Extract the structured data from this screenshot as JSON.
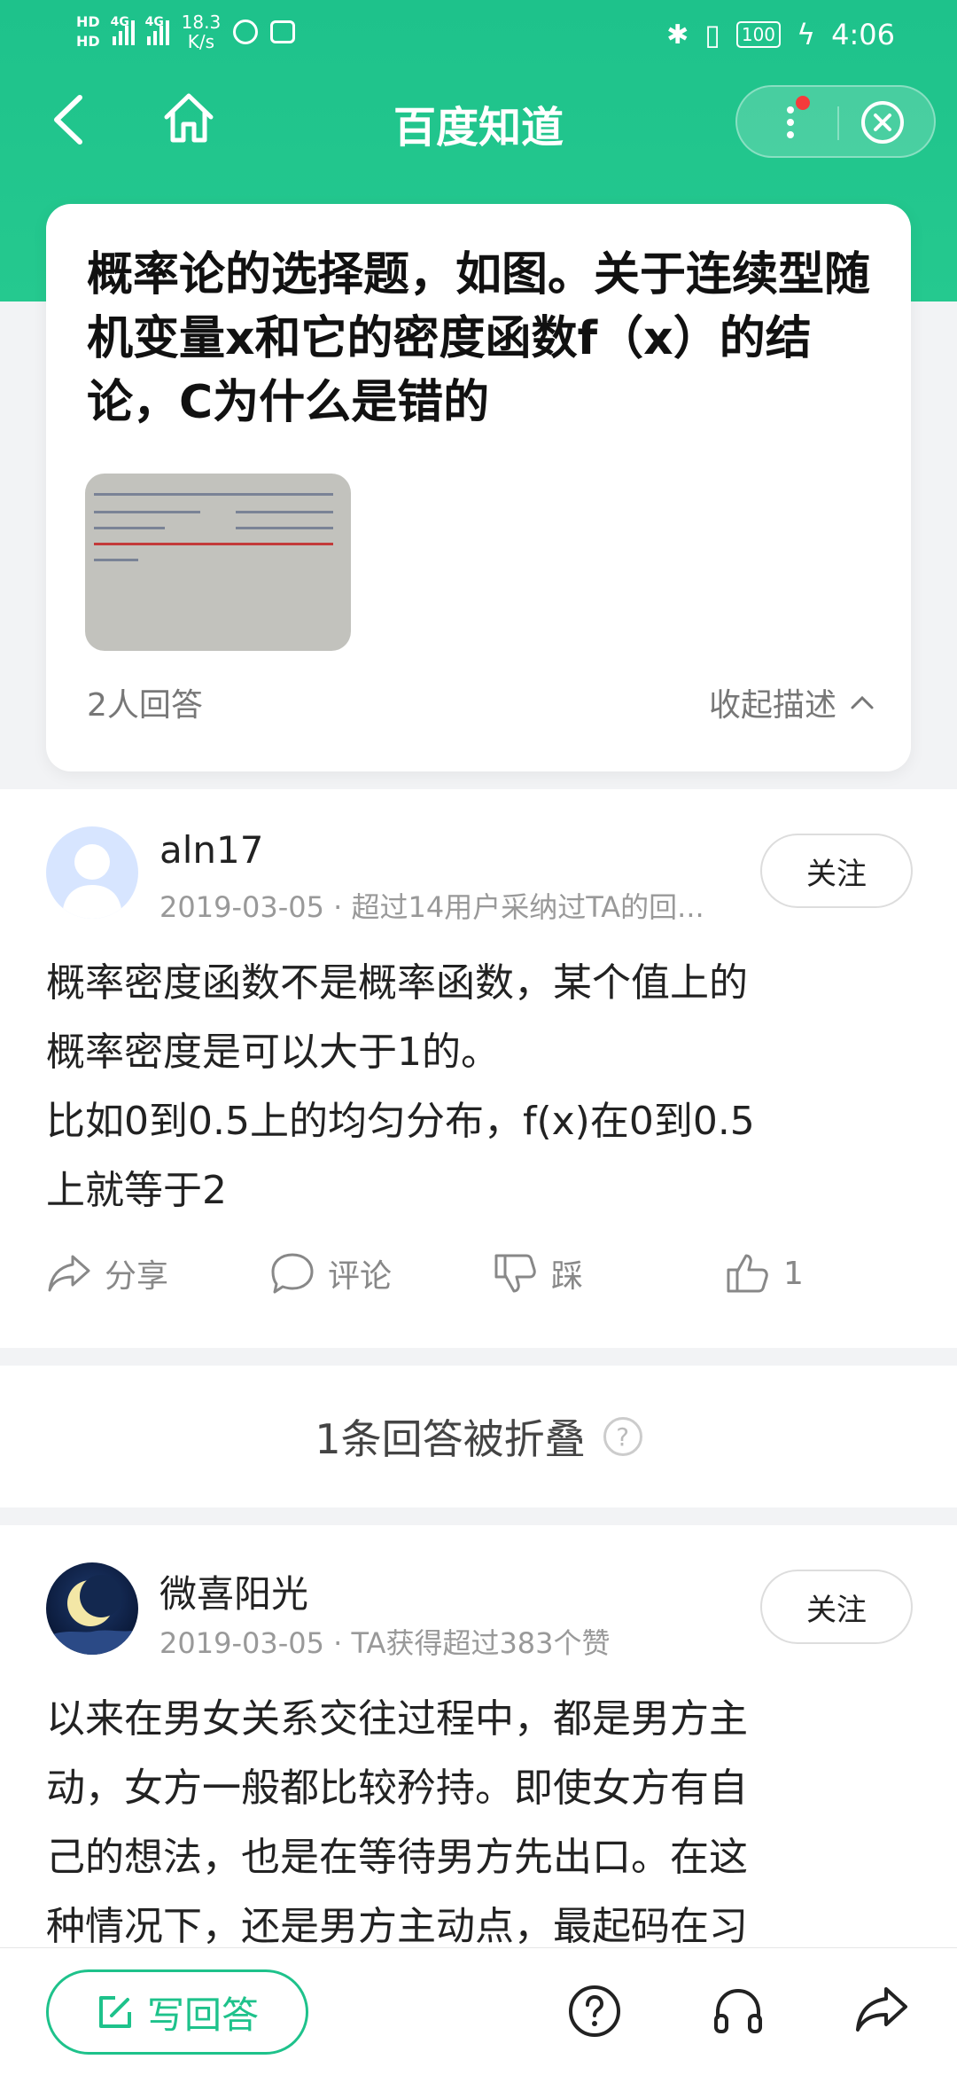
{
  "status_bar": {
    "hd1": "HD",
    "hd2": "HD",
    "net1": "4G",
    "net2": "4G",
    "speed_value": "18.3",
    "speed_unit": "K/s",
    "battery": "100",
    "time": "4:06"
  },
  "nav": {
    "title": "百度知道"
  },
  "question": {
    "title": "概率论的选择题，如图。关于连续型随机变量x和它的密度函数f（x）的结论，C为什么是错的",
    "answer_count": "2人回答",
    "collapse_label": "收起描述"
  },
  "answers": [
    {
      "name": "aln17",
      "meta": "2019-03-05 · 超过14用户采纳过TA的回...",
      "follow_label": "关注",
      "text_lines": [
        "概率密度函数不是概率函数，某个值上的",
        "概率密度是可以大于1的。",
        "比如0到0.5上的均匀分布，f(x)在0到0.5",
        "上就等于2"
      ],
      "actions": {
        "share": "分享",
        "comment": "评论",
        "dislike": "踩",
        "likes": "1"
      }
    },
    {
      "name": "微喜阳光",
      "meta": "2019-03-05 · TA获得超过383个赞",
      "follow_label": "关注",
      "text_lines": [
        "以来在男女关系交往过程中，都是男方主",
        "动，女方一般都比较矜持。即使女方有自",
        "己的想法，也是在等待男方先出口。在这",
        "种情况下，还是男方主动点，最起码在习"
      ]
    }
  ],
  "folded": {
    "label": "1条回答被折叠"
  },
  "bottom_bar": {
    "write_label": "写回答"
  },
  "colors": {
    "brand": "#1ec28b",
    "notify_dot": "#f53b3b"
  }
}
